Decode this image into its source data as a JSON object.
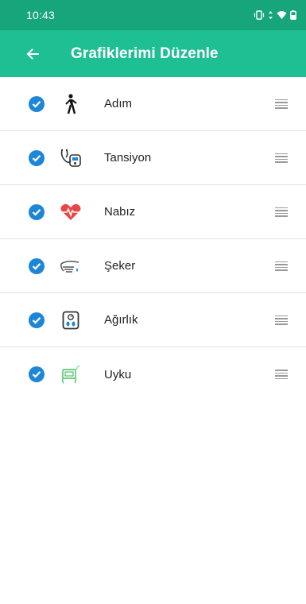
{
  "status_bar": {
    "time": "10:43"
  },
  "app_bar": {
    "title": "Grafiklerimi Düzenle"
  },
  "colors": {
    "status_bar": "#17a57c",
    "app_bar": "#1ebf92",
    "check": "#1d86d6",
    "heart": "#e94545",
    "sugar_drop": "#1d86d6",
    "sleep_green": "#3cbf5c"
  },
  "items": [
    {
      "label": "Adım",
      "icon": "walking-person-icon",
      "checked": true
    },
    {
      "label": "Tansiyon",
      "icon": "blood-pressure-icon",
      "checked": true
    },
    {
      "label": "Nabız",
      "icon": "heart-pulse-icon",
      "checked": true
    },
    {
      "label": "Şeker",
      "icon": "blood-sugar-icon",
      "checked": true
    },
    {
      "label": "Ağırlık",
      "icon": "weight-scale-icon",
      "checked": true
    },
    {
      "label": "Uyku",
      "icon": "sleep-icon",
      "checked": true
    }
  ]
}
